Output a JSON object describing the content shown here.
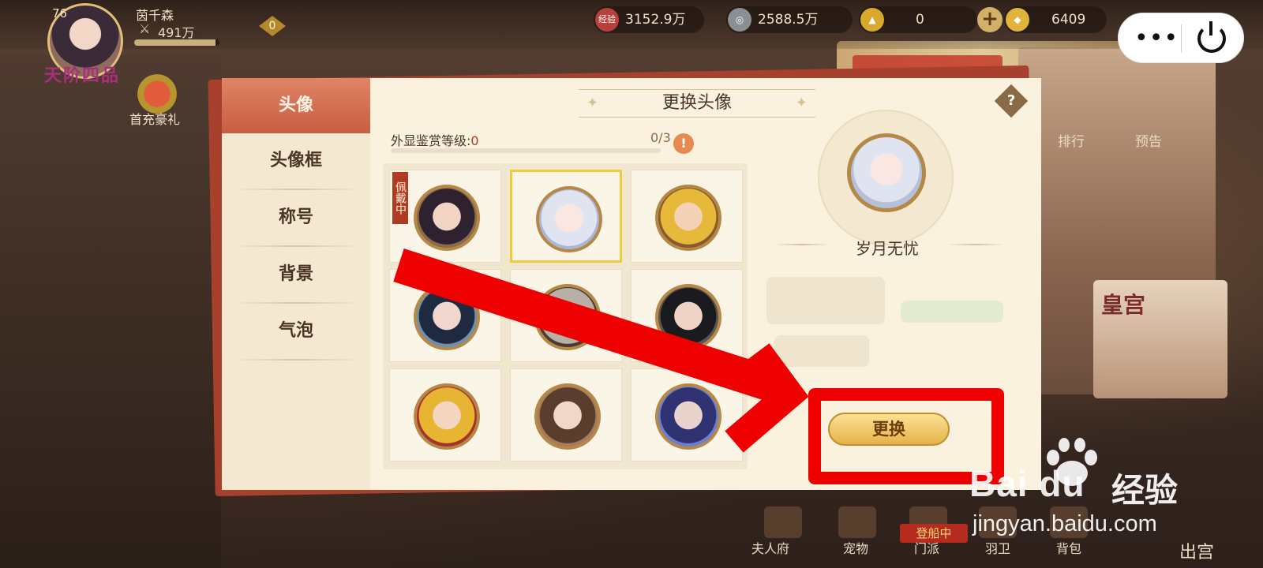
{
  "top_bar": {
    "level": "76",
    "rank": "天阶四品",
    "player_name": "茵千森",
    "power": "491万",
    "vip": "0",
    "exp_fraction": 0.95,
    "exp_badge": "经验",
    "exp_value": "3152.9万",
    "coin_value": "2588.5万",
    "ingot_value": "0",
    "gold_value": "6409"
  },
  "system_capsule": {
    "more_icon": "more-dots-icon",
    "close_icon": "power-icon"
  },
  "background": {
    "gift_label": "首充豪礼",
    "side_tags": [
      "排行",
      "预告"
    ],
    "palace_label": "皇宫",
    "bottom_nav": [
      "夫人府",
      "宠物",
      "门派",
      "羽卫",
      "背包",
      "出宫"
    ],
    "boarding_badge": "登船中"
  },
  "dialog": {
    "title": "更换头像",
    "help": "?",
    "tabs": [
      {
        "label": "头像",
        "active": true
      },
      {
        "label": "头像框",
        "active": false
      },
      {
        "label": "称号",
        "active": false
      },
      {
        "label": "背景",
        "active": false
      },
      {
        "label": "气泡",
        "active": false
      }
    ],
    "appraisal_label": "外显鉴赏等级:",
    "appraisal_value": "0",
    "appraisal_progress": "0/3",
    "warn_icon": "!",
    "wearing_tag": "佩戴中",
    "avatars": [
      {
        "id": "avatar-1",
        "wearing": true,
        "selected": false,
        "colors": [
          "#f1d4c3",
          "#2e2230",
          "#8b6a4a"
        ]
      },
      {
        "id": "avatar-2",
        "wearing": false,
        "selected": true,
        "colors": [
          "#fbe7e1",
          "#dfe4f0",
          "#aab6d4"
        ]
      },
      {
        "id": "avatar-3",
        "wearing": false,
        "selected": false,
        "colors": [
          "#f3d2b7",
          "#e6b93a",
          "#8b5a2a"
        ]
      },
      {
        "id": "avatar-4",
        "wearing": false,
        "selected": false,
        "colors": [
          "#f0d6cc",
          "#1f2a40",
          "#6f8fb0"
        ]
      },
      {
        "id": "avatar-5",
        "wearing": false,
        "selected": false,
        "colors": [
          "#e3d6cc",
          "#b8b0a6",
          "#4a3b33"
        ]
      },
      {
        "id": "avatar-6",
        "wearing": false,
        "selected": false,
        "colors": [
          "#efd4c6",
          "#1b1b1f",
          "#5a5450"
        ]
      },
      {
        "id": "avatar-7",
        "wearing": false,
        "selected": false,
        "colors": [
          "#f4d6c0",
          "#e7b532",
          "#a8322a"
        ]
      },
      {
        "id": "avatar-8",
        "wearing": false,
        "selected": false,
        "colors": [
          "#f1d7c8",
          "#5a3d2d",
          "#a47b5d"
        ]
      },
      {
        "id": "avatar-9",
        "wearing": false,
        "selected": false,
        "colors": [
          "#ead3cc",
          "#2f3170",
          "#6a7fd0"
        ]
      }
    ],
    "preview_name": "岁月无忧",
    "change_button": "更换"
  },
  "watermark": {
    "logo": "Bai du",
    "cn": "经验",
    "url": "jingyan.baidu.com"
  },
  "colors": {
    "annotation_red": "#ee0000",
    "accent_tab": "#c85d42",
    "button_gold": "#e6b34a"
  }
}
